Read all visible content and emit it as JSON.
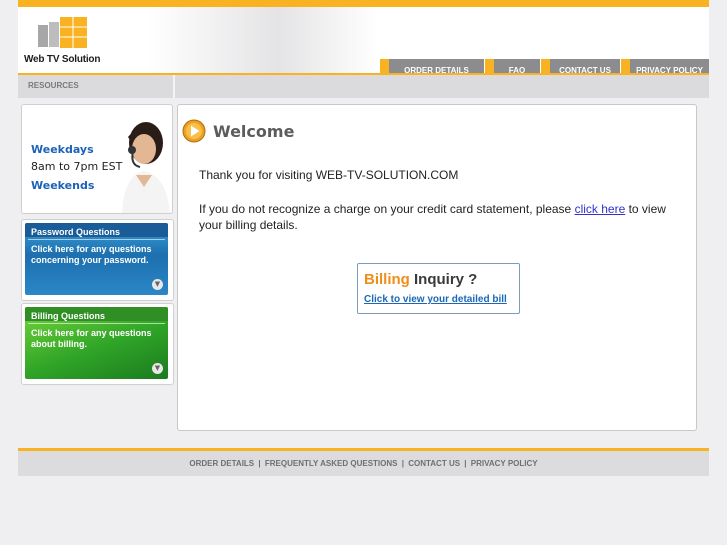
{
  "brand": {
    "name": "Web TV Solution"
  },
  "nav": {
    "tabs": [
      {
        "label": "ORDER DETAILS"
      },
      {
        "label": "FAQ"
      },
      {
        "label": "CONTACT US"
      },
      {
        "label": "PRIVACY POLICY"
      }
    ]
  },
  "resources": {
    "title": "RESOURCES"
  },
  "support_hours": {
    "weekdays_label": "Weekdays",
    "weekdays_time": "8am to 7pm EST",
    "weekends_label": "Weekends"
  },
  "promos": {
    "password": {
      "title": "Password Questions",
      "body": "Click here for any questions concerning your password."
    },
    "billing": {
      "title": "Billing Questions",
      "body": "Click here for any questions about billing."
    }
  },
  "main": {
    "title": "Welcome",
    "thanks": "Thank you for visiting WEB-TV-SOLUTION.COM",
    "notice_before": "If you do not recognize a charge on your credit card statement, please ",
    "notice_link": "click here",
    "notice_after": " to view your billing details."
  },
  "billing_button": {
    "heading_part1": "Billing",
    "heading_part2": "Inquiry ?",
    "link": "Click to view your detailed bill"
  },
  "footer": {
    "links": [
      "ORDER DETAILS",
      "FREQUENTLY ASKED QUESTIONS",
      "CONTACT US",
      "PRIVACY POLICY"
    ],
    "separator": "|"
  },
  "colors": {
    "accent": "#f9b222",
    "tab_bg": "#8c8c8e",
    "link_blue": "#1b67b7",
    "title_gray": "#5c5c5c"
  },
  "icons": {
    "logo": "stacked-boxes-icon",
    "welcome": "play-arrow-icon",
    "promo_arrow": "chevron-down-icon"
  }
}
